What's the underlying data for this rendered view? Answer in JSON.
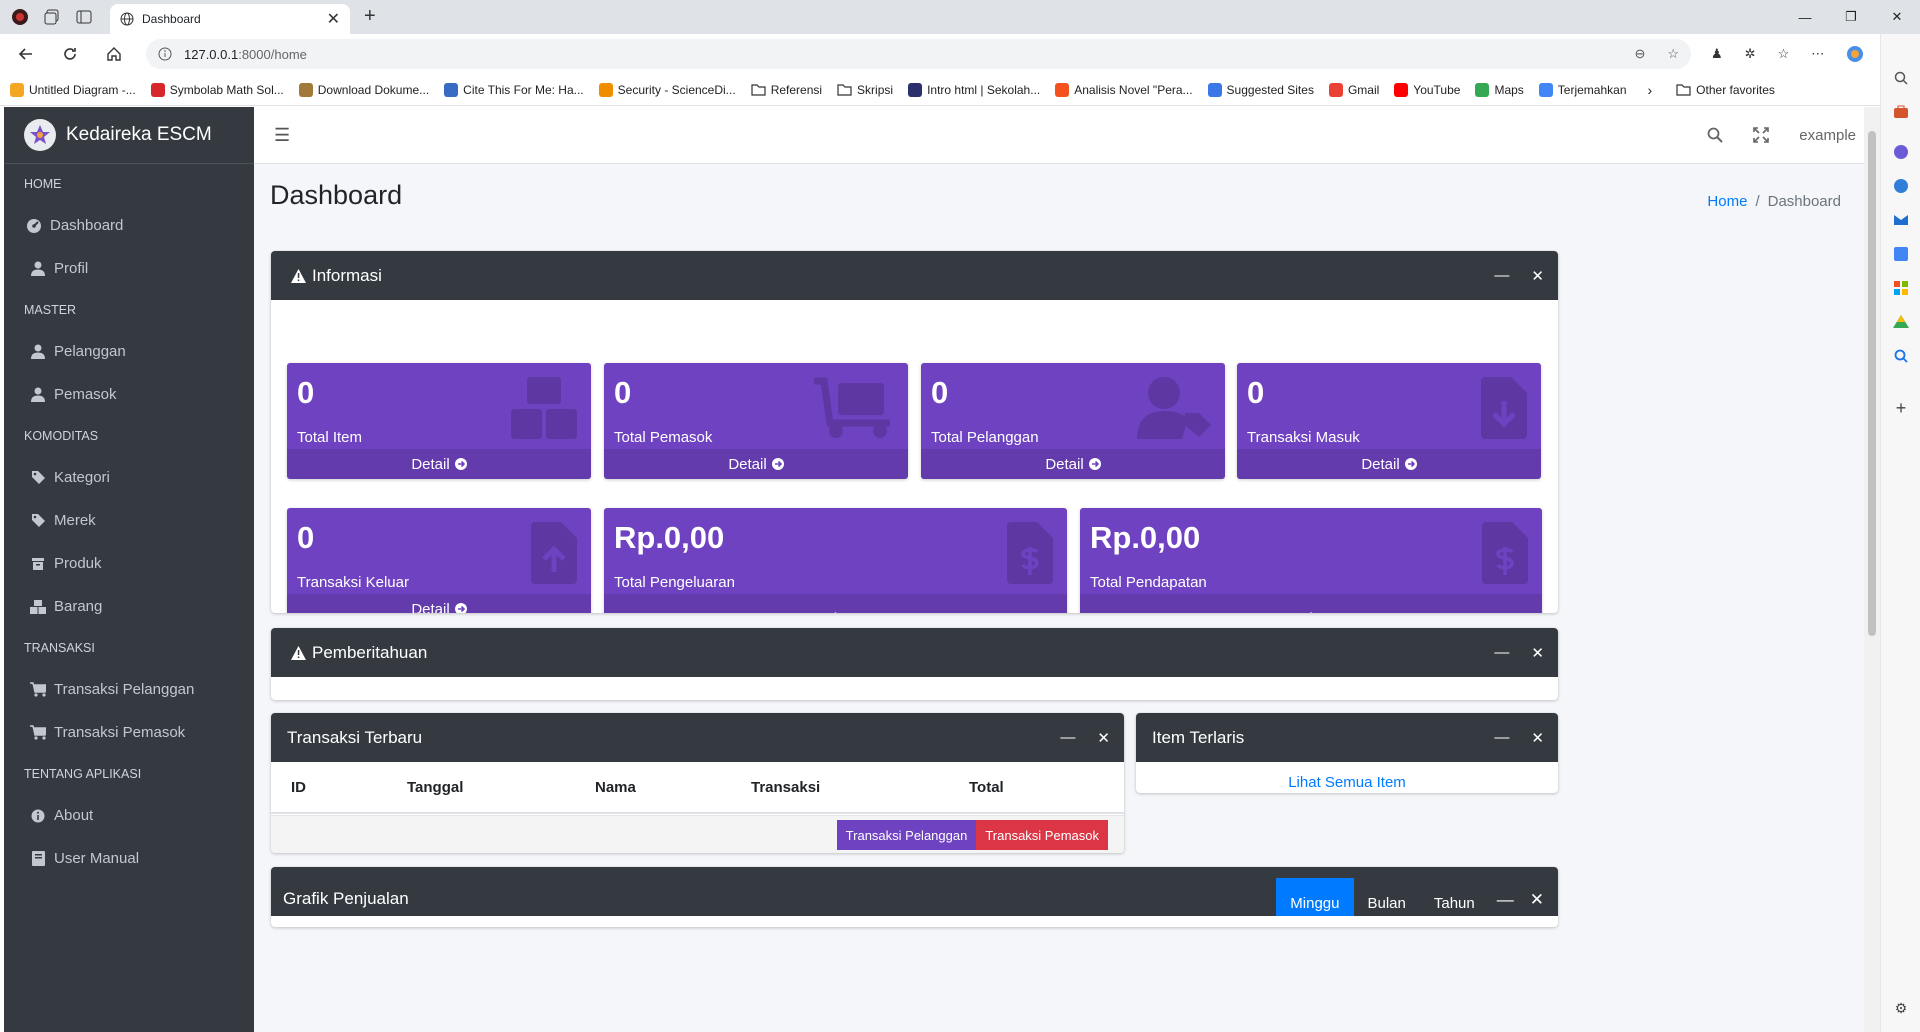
{
  "browser": {
    "tab_title": "Dashboard",
    "url_host": "127.0.0.1",
    "url_path": ":8000/home",
    "bookmarks": [
      {
        "label": "Untitled Diagram -...",
        "color": "#f5a623"
      },
      {
        "label": "Symbolab Math Sol...",
        "color": "#d6272b"
      },
      {
        "label": "Download Dokume...",
        "color": "#a17a3b"
      },
      {
        "label": "Cite This For Me: Ha...",
        "color": "#3a6bc4"
      },
      {
        "label": "Security - ScienceDi...",
        "color": "#f08c00"
      },
      {
        "label": "Referensi",
        "color": "folder"
      },
      {
        "label": "Skripsi",
        "color": "folder"
      },
      {
        "label": "Intro html | Sekolah...",
        "color": "#2b2f6b"
      },
      {
        "label": "Analisis Novel \"Pera...",
        "color": "#f4511e"
      },
      {
        "label": "Suggested Sites",
        "color": "#3b78e7"
      },
      {
        "label": "Gmail",
        "color": "#ea4335"
      },
      {
        "label": "YouTube",
        "color": "#ff0000"
      },
      {
        "label": "Maps",
        "color": "#34a853"
      },
      {
        "label": "Terjemahkan",
        "color": "#4285f4"
      }
    ],
    "other_favorites": "Other favorites"
  },
  "sidebar": {
    "brand": "Kedaireka ESCM",
    "sections": [
      {
        "header": "HOME",
        "items": [
          {
            "label": "Dashboard",
            "icon": "dashboard-icon"
          },
          {
            "label": "Profil",
            "icon": "user-icon"
          }
        ]
      },
      {
        "header": "MASTER",
        "items": [
          {
            "label": "Pelanggan",
            "icon": "user-icon"
          },
          {
            "label": "Pemasok",
            "icon": "user-icon"
          }
        ]
      },
      {
        "header": "KOMODITAS",
        "items": [
          {
            "label": "Kategori",
            "icon": "tag-icon"
          },
          {
            "label": "Merek",
            "icon": "tag-icon"
          },
          {
            "label": "Produk",
            "icon": "box-icon"
          },
          {
            "label": "Barang",
            "icon": "boxes-icon"
          }
        ]
      },
      {
        "header": "TRANSAKSI",
        "items": [
          {
            "label": "Transaksi Pelanggan",
            "icon": "cart-icon"
          },
          {
            "label": "Transaksi Pemasok",
            "icon": "cart-icon"
          }
        ]
      },
      {
        "header": "TENTANG APLIKASI",
        "items": [
          {
            "label": "About",
            "icon": "info-icon"
          },
          {
            "label": "User Manual",
            "icon": "book-icon"
          }
        ]
      }
    ]
  },
  "topnav": {
    "user": "example"
  },
  "page": {
    "title": "Dashboard",
    "breadcrumb_home": "Home",
    "breadcrumb_current": "Dashboard"
  },
  "informasi": {
    "title": "Informasi",
    "boxes_row1": [
      {
        "value": "0",
        "label": "Total Item",
        "footer": "Detail",
        "icon": "boxes-icon"
      },
      {
        "value": "0",
        "label": "Total Pemasok",
        "footer": "Detail",
        "icon": "dolly-icon"
      },
      {
        "value": "0",
        "label": "Total Pelanggan",
        "footer": "Detail",
        "icon": "user-tag-icon"
      },
      {
        "value": "0",
        "label": "Transaksi Masuk",
        "footer": "Detail",
        "icon": "file-download-icon"
      }
    ],
    "boxes_row2": [
      {
        "value": "0",
        "label": "Transaksi Keluar",
        "footer": "Detail",
        "icon": "file-upload-icon"
      },
      {
        "value": "Rp.0,00",
        "label": "Total Pengeluaran",
        "footer": ".",
        "icon": "file-invoice-dollar-icon"
      },
      {
        "value": "Rp.0,00",
        "label": "Total Pendapatan",
        "footer": ".",
        "icon": "file-invoice-dollar-icon"
      }
    ]
  },
  "pemberitahuan": {
    "title": "Pemberitahuan"
  },
  "transaksi_terbaru": {
    "title": "Transaksi Terbaru",
    "columns": [
      "ID",
      "Tanggal",
      "Nama",
      "Transaksi",
      "Total"
    ],
    "btn_pelanggan": "Transaksi Pelanggan",
    "btn_pemasok": "Transaksi Pemasok"
  },
  "item_terlaris": {
    "title": "Item Terlaris",
    "link": "Lihat Semua Item"
  },
  "grafik": {
    "title": "Grafik Penjualan",
    "tabs": [
      "Minggu",
      "Bulan",
      "Tahun"
    ]
  },
  "colors": {
    "purple": "#6f42c1",
    "dark": "#343a40",
    "primary": "#007bff",
    "danger": "#dc3545"
  }
}
